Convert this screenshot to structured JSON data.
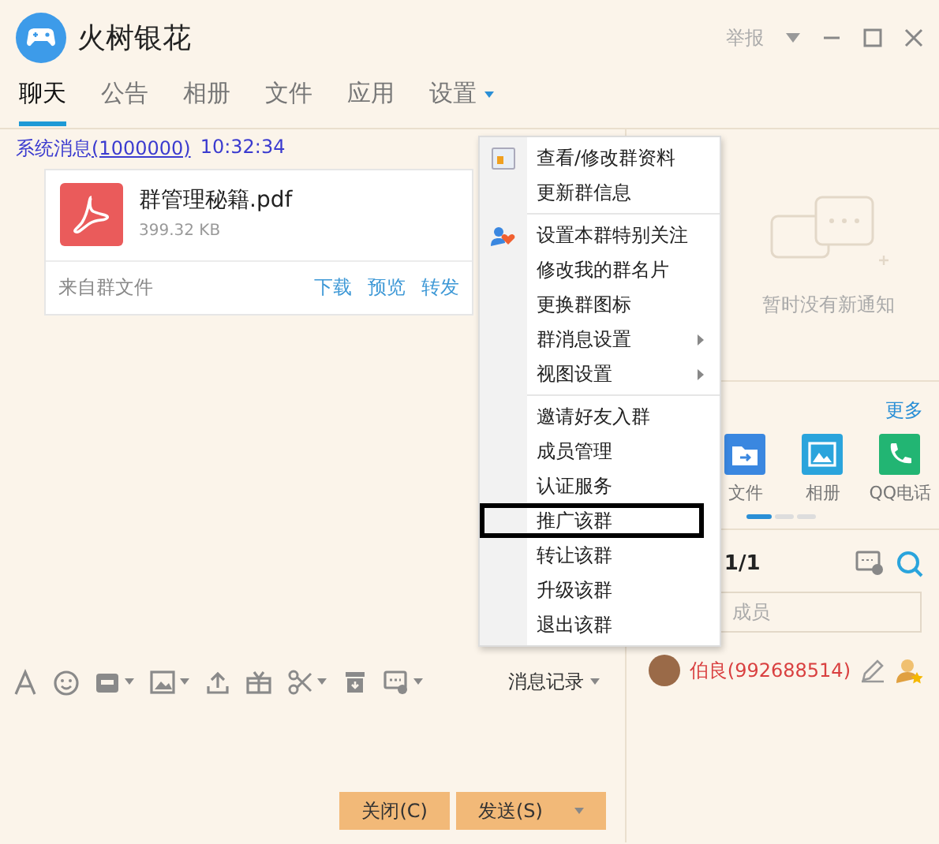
{
  "window": {
    "title": "火树银花",
    "report": "举报"
  },
  "tabs": [
    {
      "label": "聊天",
      "selected": true,
      "has_menu": false
    },
    {
      "label": "公告",
      "selected": false,
      "has_menu": false
    },
    {
      "label": "相册",
      "selected": false,
      "has_menu": false
    },
    {
      "label": "文件",
      "selected": false,
      "has_menu": false
    },
    {
      "label": "应用",
      "selected": false,
      "has_menu": false
    },
    {
      "label": "设置",
      "selected": false,
      "has_menu": true
    }
  ],
  "chat": {
    "messages": [
      {
        "sender": "系统消息",
        "sender_id": "(1000000)",
        "time": "10:32:34",
        "file": {
          "name": "群管理秘籍.pdf",
          "size": "399.32 KB",
          "source": "来自群文件",
          "actions": [
            "下载",
            "预览",
            "转发"
          ]
        }
      }
    ]
  },
  "toolbar": {
    "history_label": "消息记录"
  },
  "buttons": [
    {
      "label": "关闭(C)",
      "split": false
    },
    {
      "label": "发送(S)",
      "split": true
    }
  ],
  "notice_panel": {
    "empty_text": "暂时没有新通知"
  },
  "apps": {
    "more": "更多",
    "items": [
      {
        "label": "文件",
        "kind": "file"
      },
      {
        "label": "相册",
        "kind": "album"
      },
      {
        "label": "QQ电话",
        "kind": "phone"
      }
    ]
  },
  "members": {
    "count": "1/1",
    "search": {
      "placeholder": "成员"
    },
    "items": [
      {
        "name": "伯良(992688514)"
      }
    ]
  },
  "menu": {
    "groups": [
      [
        {
          "label": "查看/修改群资料",
          "submenu": false,
          "highlighted": false
        },
        {
          "label": "更新群信息",
          "submenu": false,
          "highlighted": false
        }
      ],
      [
        {
          "label": "设置本群特别关注",
          "submenu": false,
          "highlighted": false
        },
        {
          "label": "修改我的群名片",
          "submenu": false,
          "highlighted": false
        },
        {
          "label": "更换群图标",
          "submenu": false,
          "highlighted": false
        },
        {
          "label": "群消息设置",
          "submenu": true,
          "highlighted": false
        },
        {
          "label": "视图设置",
          "submenu": true,
          "highlighted": false
        }
      ],
      [
        {
          "label": "邀请好友入群",
          "submenu": false,
          "highlighted": false
        },
        {
          "label": "成员管理",
          "submenu": false,
          "highlighted": false
        },
        {
          "label": "认证服务",
          "submenu": false,
          "highlighted": false
        },
        {
          "label": "推广该群",
          "submenu": false,
          "highlighted": true
        },
        {
          "label": "转让该群",
          "submenu": false,
          "highlighted": false
        },
        {
          "label": "升级该群",
          "submenu": false,
          "highlighted": false
        },
        {
          "label": "退出该群",
          "submenu": false,
          "highlighted": false
        }
      ]
    ]
  }
}
